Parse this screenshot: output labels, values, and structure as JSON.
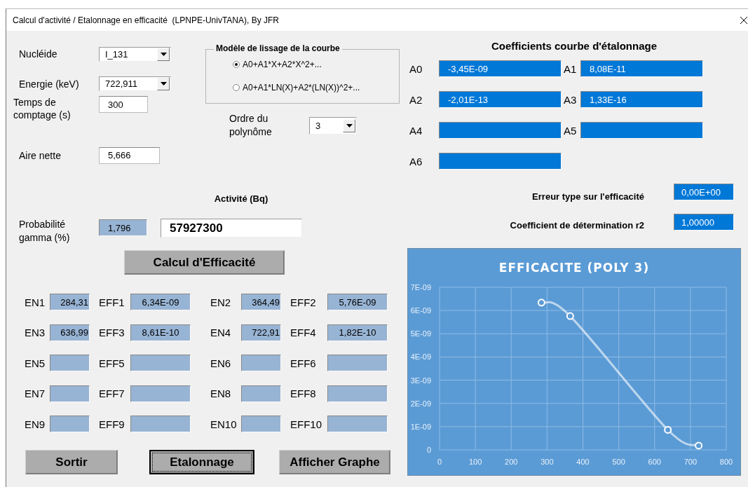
{
  "window": {
    "title": "Calcul d'activité / Etalonnage en efficacité  (LPNPE-UnivTANA), By JFR"
  },
  "inputs": [
    {
      "kind": "combo",
      "label": "Nucléide",
      "value": "I_131"
    },
    {
      "kind": "combo",
      "label": "Energie (keV)",
      "value": "722,911"
    },
    {
      "kind": "text",
      "label": "Temps de comptage (s)",
      "value": "300"
    },
    {
      "kind": "text",
      "label": "Aire nette",
      "value": "5,666"
    }
  ],
  "fit_model": {
    "title": "Modèle de lissage de la courbe",
    "options": [
      {
        "label": "A0+A1*X+A2*X^2+...",
        "selected": true
      },
      {
        "label": "A0+A1*LN(X)+A2*(LN(X))^2+...",
        "selected": false
      }
    ]
  },
  "order": {
    "label": "Ordre du polynôme",
    "value": "3"
  },
  "activity": {
    "label": "Activité (Bq)",
    "value": "57927300"
  },
  "gamma": {
    "label": "Probabilité gamma (%)",
    "value": "1,796"
  },
  "calc_button": {
    "label": "Calcul d'Efficacité",
    "focused": false
  },
  "points": [
    {
      "en_label": "EN1",
      "en": "284,31",
      "eff_label": "EFF1",
      "eff": "6,34E-09"
    },
    {
      "en_label": "EN2",
      "en": "364,49",
      "eff_label": "EFF2",
      "eff": "5,76E-09"
    },
    {
      "en_label": "EN3",
      "en": "636,99",
      "eff_label": "EFF3",
      "eff": "8,61E-10"
    },
    {
      "en_label": "EN4",
      "en": "722,91",
      "eff_label": "EFF4",
      "eff": "1,82E-10"
    },
    {
      "en_label": "EN5",
      "eff_label": "EFF5"
    },
    {
      "en_label": "EN6",
      "eff_label": "EFF6"
    },
    {
      "en_label": "EN7",
      "eff_label": "EFF7"
    },
    {
      "en_label": "EN8",
      "eff_label": "EFF8"
    },
    {
      "en_label": "EN9",
      "eff_label": "EFF9"
    },
    {
      "en_label": "EN10",
      "eff_label": "EFF10"
    }
  ],
  "buttons": [
    {
      "label": "Sortir",
      "focused": false
    },
    {
      "label": "Etalonnage",
      "focused": true
    },
    {
      "label": "Afficher Graphe",
      "focused": false
    }
  ],
  "coefficients_title": "Coefficients courbe d'étalonnage",
  "coefficients": [
    {
      "label": "A0",
      "value": "-3,45E-09"
    },
    {
      "label": "A1",
      "value": "8,08E-11"
    },
    {
      "label": "A2",
      "value": "-2,01E-13"
    },
    {
      "label": "A3",
      "value": "1,33E-16"
    },
    {
      "label": "A4"
    },
    {
      "label": "A5"
    },
    {
      "label": "A6"
    }
  ],
  "std_error": {
    "label": "Erreur type sur l'efficacité",
    "value": "0,00E+00"
  },
  "r2": {
    "label": "Coefficient de détermination r2",
    "value": "1,00000"
  },
  "chart": {
    "chart_data": {
      "type": "line",
      "grid": true,
      "title": "EFFICACITE  (POLY 3)",
      "x": [
        284.31,
        364.49,
        636.99,
        722.91
      ],
      "series": [
        {
          "color": "#ffffff",
          "marker": "circle",
          "values": [
            6.34e-09,
            5.76e-09,
            8.61e-10,
            1.82e-10
          ]
        }
      ],
      "xlim": [
        0,
        800
      ],
      "ylim": [
        0,
        7e-09
      ],
      "xticks": [
        0,
        100,
        200,
        300,
        400,
        500,
        600,
        700,
        800
      ],
      "yticks": [
        {
          "value": 0,
          "label": "0"
        },
        {
          "value": 1e-09,
          "label": "1E-09"
        },
        {
          "value": 2e-09,
          "label": "2E-09"
        },
        {
          "value": 3e-09,
          "label": "3E-09"
        },
        {
          "value": 4e-09,
          "label": "4E-09"
        },
        {
          "value": 5e-09,
          "label": "5E-09"
        },
        {
          "value": 6e-09,
          "label": "6E-09"
        },
        {
          "value": 7e-09,
          "label": "7E-09"
        }
      ]
    }
  }
}
